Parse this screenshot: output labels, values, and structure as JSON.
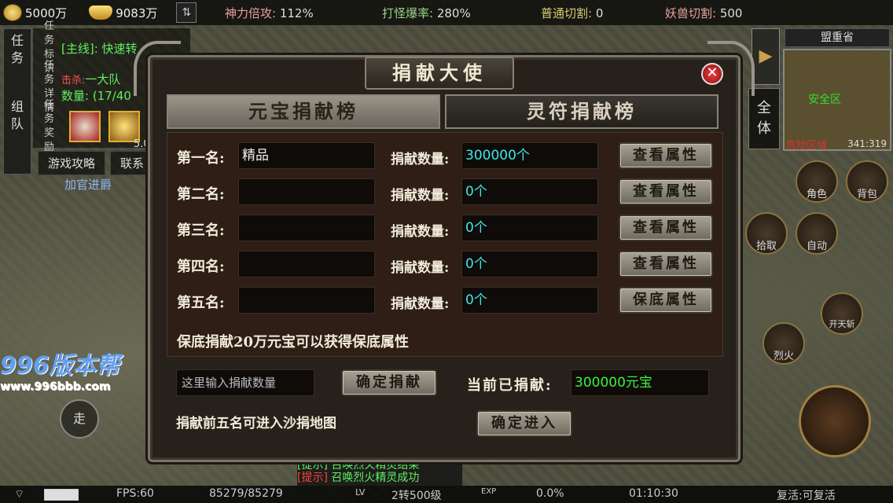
{
  "top": {
    "coin": "5000万",
    "ingot": "9083万",
    "stats": [
      {
        "label": "神力倍攻:",
        "value": "112%"
      },
      {
        "label": "打怪爆率:",
        "value": "280%"
      },
      {
        "label": "普通切割:",
        "value": "0"
      },
      {
        "label": "妖兽切割:",
        "value": "500"
      }
    ]
  },
  "left": {
    "nav": [
      "任",
      "务",
      "组",
      "队"
    ],
    "task_rows": [
      {
        "label": "任务标识",
        "text": "[主线]: 快速转"
      },
      {
        "label": "任务详情",
        "text_red": "击杀:",
        "text": "一大队",
        "sub": "数量: (17/40"
      },
      {
        "label": "任务奖励",
        "text": "5.00"
      }
    ],
    "buttons": [
      "游戏攻略",
      "联系"
    ],
    "jiaguan": "加官进爵",
    "logo": "996版本帮",
    "url": "www.996bbb.com",
    "walk": "走"
  },
  "right": {
    "map_name": "盟重省",
    "safe": "安全区",
    "danger": "危险区域",
    "coord": "341:319",
    "quanti": [
      "全",
      "体"
    ],
    "buttons": [
      "角色",
      "背包",
      "拾取",
      "自动",
      "开天斩",
      "烈火"
    ]
  },
  "modal": {
    "title": "捐献大使",
    "tab_active": "元宝捐献榜",
    "tab_inactive": "灵符捐献榜",
    "amount_label": "捐献数量:",
    "ranks": [
      {
        "label": "第一名:",
        "name": "精品",
        "amount": "300000个",
        "button": "查看属性"
      },
      {
        "label": "第二名:",
        "name": "",
        "amount": "0个",
        "button": "查看属性"
      },
      {
        "label": "第三名:",
        "name": "",
        "amount": "0个",
        "button": "查看属性"
      },
      {
        "label": "第四名:",
        "name": "",
        "amount": "0个",
        "button": "查看属性"
      },
      {
        "label": "第五名:",
        "name": "",
        "amount": "0个",
        "button": "保底属性"
      }
    ],
    "baodi_text": "保底捐献20万元宝可以获得保底属性",
    "input_placeholder": "这里输入捐献数量",
    "confirm_donate": "确定捐献",
    "current_label": "当前已捐献:",
    "current_value": "300000元宝",
    "enter_text": "捐献前五名可进入沙捐地图",
    "confirm_enter": "确定进入"
  },
  "chat": {
    "line1": "[提示] 召唤烈火精灵结果",
    "line2_tag": "[提示]",
    "line2": "召唤烈火精灵成功"
  },
  "status": {
    "fps": "FPS:60",
    "hp": "85279/85279",
    "lv_tag": "LV",
    "level": "2转500级",
    "exp_tag": "EXP",
    "exp": "0.0%",
    "time": "01:10:30",
    "revive": "复活:可复活"
  }
}
